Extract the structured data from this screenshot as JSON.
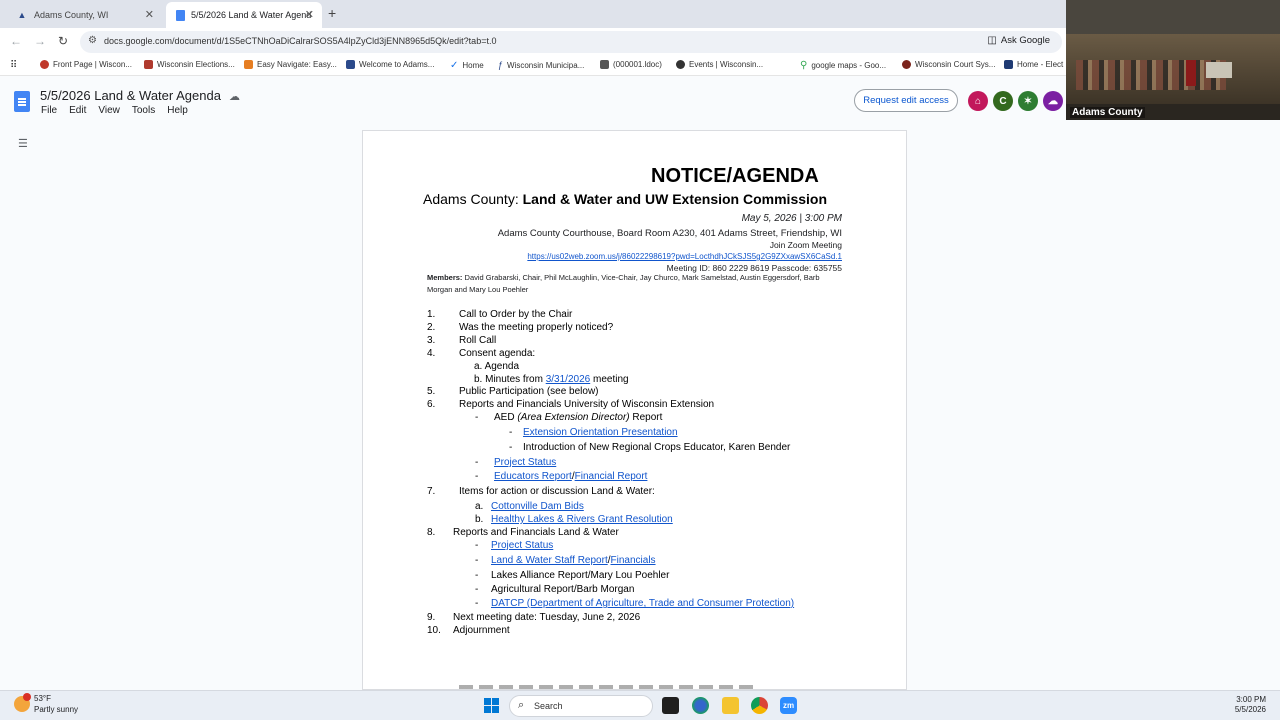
{
  "browser": {
    "tabs": [
      {
        "title": "Adams County, WI"
      },
      {
        "title": "5/5/2026 Land & Water Agend"
      }
    ],
    "url": "docs.google.com/document/d/1S5eCTNhOaDiCalrarSOS5A4lpZyCld3jENN8965d5Qk/edit?tab=t.0",
    "ask_google": "Ask Google",
    "bookmarks": [
      "Front Page | Wiscon...",
      "Wisconsin Elections...",
      "Easy Navigate: Easy...",
      "Welcome to Adams...",
      "Home",
      "Wisconsin Municipa...",
      "(000001.ldoc)",
      "Events | Wisconsin...",
      "google maps - Goo...",
      "Wisconsin Court Sys...",
      "Home - Elect"
    ]
  },
  "docs": {
    "title": "5/5/2026 Land & Water Agenda",
    "menu": [
      "File",
      "Edit",
      "View",
      "Tools",
      "Help"
    ],
    "request_edit": "Request edit access",
    "avatars": [
      {
        "letter": "C",
        "color": "#33691e"
      }
    ]
  },
  "video": {
    "label": "Adams County"
  },
  "agenda": {
    "heading": "NOTICE/AGENDA",
    "subtitle_prefix": "Adams County:",
    "subtitle_bold": "Land & Water and UW Extension Commission",
    "date_time": "May 5, 2026 |   3:00 PM",
    "location": "Adams County Courthouse, Board Room A230, 401 Adams Street, Friendship, WI",
    "zoom_label": "Join Zoom Meeting",
    "zoom_link": "https://us02web.zoom.us/j/86022298619?pwd=LocthdhJCkSJS5g2G9ZXxawSX6CaSd.1",
    "meeting_id": "Meeting ID: 860 2229 8619    Passcode: 635755",
    "members_label": "Members:",
    "members_text": "David Grabarski, Chair, Phil McLaughlin, Vice-Chair, Jay Churco, Mark Samelstad, Austin Eggersdorf,  Barb Morgan and Mary Lou Poehler",
    "items": {
      "i1": "Call to Order by the Chair",
      "i2": "Was the meeting properly noticed?",
      "i3": "Roll Call",
      "i4": "Consent agenda:",
      "i4a": "a. Agenda",
      "i4b_pre": "b. Minutes from",
      "i4b_link": "3/31/2026",
      "i4b_post": "meeting",
      "i5": "Public Participation (see below)",
      "i6": "Reports and Financials University of Wisconsin Extension",
      "i6a_pre": "AED",
      "i6a_ital": "(Area Extension Director)",
      "i6a_post": "Report",
      "i6a1": "Extension Orientation Presentation",
      "i6a2": "Introduction of New Regional Crops Educator, Karen Bender",
      "i6b": "Project Status",
      "i6c1": "Educators Report",
      "i6c_sep": "/",
      "i6c2": "Financial Report",
      "i7": "Items for action or discussion Land & Water:",
      "i7a_l": "a.",
      "i7a": "Cottonville Dam Bids",
      "i7b_l": "b.",
      "i7b": "Healthy Lakes & Rivers Grant Resolution",
      "i8": "Reports and Financials Land & Water",
      "i8a": "Project Status",
      "i8b1": "Land & Water Staff Report",
      "i8b_sep": "/",
      "i8b2": "Financials",
      "i8c": "Lakes Alliance Report/Mary Lou Poehler",
      "i8d": "Agricultural Report/Barb Morgan",
      "i8e": "DATCP (Department of Agriculture, Trade and Consumer Protection)",
      "i9": "Next meeting date:  Tuesday, June 2, 2026",
      "i10": "Adjournment"
    },
    "numbers": [
      "1.",
      "2.",
      "3.",
      "4.",
      "5.",
      "6.",
      "7.",
      "8.",
      "9.",
      "10."
    ]
  },
  "taskbar": {
    "temp": "53°F",
    "weather": "Partly sunny",
    "search": "Search",
    "time": "3:00 PM",
    "date": "5/5/2026"
  },
  "colors": {
    "link": "#1155cc",
    "docs_blue": "#4285f4",
    "edit_button_text": "#0b57d0"
  }
}
